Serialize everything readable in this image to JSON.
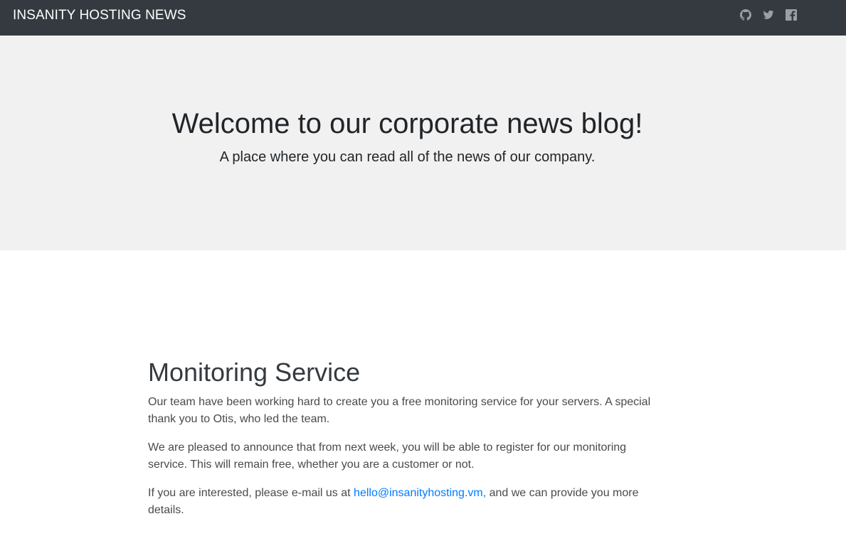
{
  "navbar": {
    "brand": "INSANITY HOSTING NEWS",
    "social": [
      {
        "icon": "github-icon"
      },
      {
        "icon": "twitter-icon"
      },
      {
        "icon": "facebook-icon"
      }
    ],
    "icon_color": "#9aa0a6",
    "background": "#343a40"
  },
  "hero": {
    "title": "Welcome to our corporate news blog!",
    "subtitle": "A place where you can read all of the news of our company."
  },
  "post": {
    "title": "Monitoring Service",
    "paragraph1": "Our team have been working hard to create you a free monitoring service for your servers. A special thank you to Otis, who led the team.",
    "paragraph2": "We are pleased to announce that from next week, you will be able to register for our monitoring service. This will remain free, whether you are a customer or not.",
    "paragraph3_before": "If you are interested, please e-mail us at ",
    "email_link": "hello@insanityhosting.vm,",
    "paragraph3_after": " and we can provide you more details."
  },
  "colors": {
    "link": "#007bff",
    "jumbotron_bg": "#f1f1f1"
  }
}
